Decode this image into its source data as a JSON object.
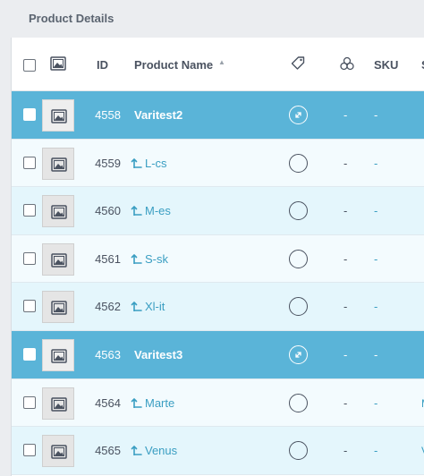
{
  "panel": {
    "title": "Product Details"
  },
  "columns": {
    "id": "ID",
    "name": "Product Name",
    "sku": "SKU",
    "edge": "S"
  },
  "icons": {
    "image": "image-icon",
    "tag": "tag-icon",
    "attributes": "attributes-icon",
    "sort": "sort-asc-icon",
    "variation": "variation-arrow-icon",
    "expand": "expand-icon"
  },
  "colors": {
    "parent_row": "#5ab4d8",
    "link": "#3a9ec2",
    "row_light": "#f3fbfe",
    "row_alt": "#e4f6fc"
  },
  "rows": [
    {
      "id": "4558",
      "name": "Varitest2",
      "type": "parent",
      "col_a": "-",
      "col_b": "-"
    },
    {
      "id": "4559",
      "name": "L-cs",
      "type": "child",
      "col_a": "-",
      "col_b": "-"
    },
    {
      "id": "4560",
      "name": "M-es",
      "type": "child",
      "col_a": "-",
      "col_b": "-"
    },
    {
      "id": "4561",
      "name": "S-sk",
      "type": "child",
      "col_a": "-",
      "col_b": "-"
    },
    {
      "id": "4562",
      "name": "Xl-it",
      "type": "child",
      "col_a": "-",
      "col_b": "-"
    },
    {
      "id": "4563",
      "name": "Varitest3",
      "type": "parent",
      "col_a": "-",
      "col_b": "-"
    },
    {
      "id": "4564",
      "name": "Marte",
      "type": "child",
      "col_a": "-",
      "col_b": "-",
      "edge": "M"
    },
    {
      "id": "4565",
      "name": "Venus",
      "type": "child",
      "col_a": "-",
      "col_b": "-",
      "edge": "V"
    }
  ]
}
